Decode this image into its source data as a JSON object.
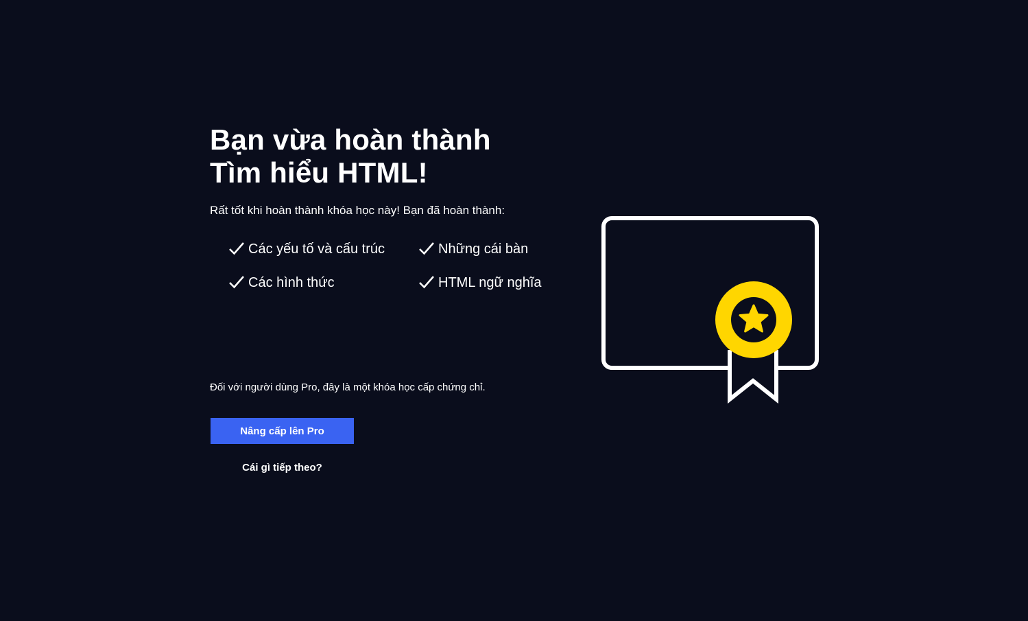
{
  "heading": {
    "line1": "Bạn vừa hoàn thành",
    "line2": "Tìm hiểu HTML!"
  },
  "subtitle": "Rất tốt khi hoàn thành khóa học này! Bạn đã hoàn thành:",
  "completed_topics": [
    "Các yếu tố và cấu trúc",
    "Những cái bàn",
    "Các hình thức",
    "HTML ngữ nghĩa"
  ],
  "pro_note": "Đối với người dùng Pro, đây là một khóa học cấp chứng chỉ.",
  "upgrade_button_label": "Nâng cấp lên Pro",
  "next_link_label": "Cái gì tiếp theo?",
  "icons": {
    "check": "check-icon",
    "certificate": "certificate-icon",
    "medal": "medal-icon",
    "star": "star-icon"
  },
  "colors": {
    "background": "#0a0d1c",
    "text": "#ffffff",
    "button": "#3a63f2",
    "medal": "#ffd600"
  }
}
